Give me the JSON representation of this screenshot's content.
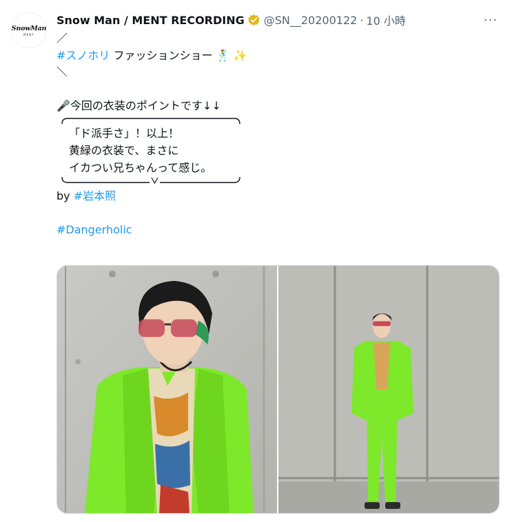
{
  "author": {
    "name": "Snow Man / MENT RECORDING",
    "handle": "@SN__20200122",
    "time": "10 小時",
    "avatar_logo": "SnowMan",
    "avatar_sub": "MENT"
  },
  "more_glyph": "···",
  "post": {
    "line1": "／",
    "hashtag1": "#スノホリ",
    "line2_rest": " ファッションショー 🕺 ✨",
    "line3": "＼",
    "intro_emoji": "🎤",
    "intro": "今回の衣装のポイントです↓↓",
    "box_lines": [
      "「ド派手さ」！以上！",
      "黄緑の衣装で、まさに",
      "イカつい兄ちゃんって感じ。"
    ],
    "by_text": "by ",
    "by_tag": "#岩本照",
    "hashtag2": "#Dangerholic"
  },
  "colors": {
    "link": "#1d9bf0",
    "secondary": "#536471",
    "suit_green": "#7ee82a",
    "verified_gold": "#e2b719"
  },
  "icons": {
    "verified": "gold-verified-badge-icon",
    "more": "more-dots-icon"
  }
}
